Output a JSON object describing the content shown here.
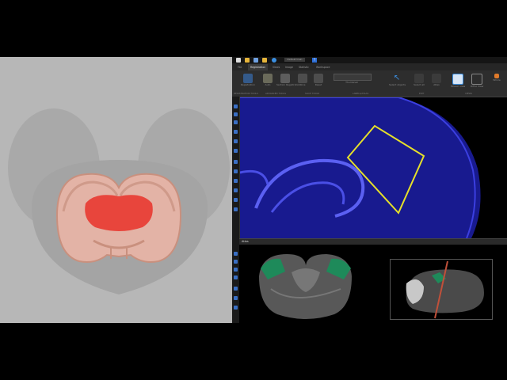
{
  "app": {
    "document_title": "Default train",
    "help_label": "?",
    "tabs": [
      "File",
      "Registration",
      "Views",
      "Image",
      "Statistic",
      "Workspace"
    ],
    "active_tab": "Registration",
    "ribbon": {
      "buttons": [
        {
          "label": "Registration"
        },
        {
          "label": "Auto"
        },
        {
          "label": "Section Registration"
        },
        {
          "label": "Slice"
        },
        {
          "label": "Reset"
        },
        {
          "label": "Thumbnail"
        },
        {
          "label": "Select objects"
        },
        {
          "label": "Select all"
        },
        {
          "label": "Atlas"
        },
        {
          "label": "Mosaic view"
        },
        {
          "label": "Ortho View"
        },
        {
          "label": "Whole"
        }
      ],
      "group_labels": [
        "REGISTRATION TOOLS",
        "ADVANCED TOOLS",
        "SLICE TOOLS",
        "LABELS/ATLAS",
        "EDIT",
        "VIEWS"
      ]
    },
    "atlas_panel": {
      "title": "Atlas"
    }
  },
  "colors": {
    "highlight_region": "#e8453c",
    "roi_outline": "#e6e02a",
    "tissue_stain": "#1c1fa8",
    "atlas_region": "#1e8a5a",
    "probe_line": "#c0503a"
  }
}
